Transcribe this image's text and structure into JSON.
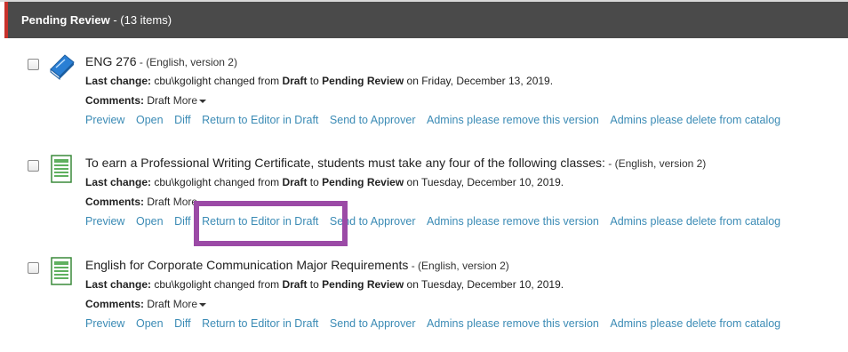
{
  "header": {
    "title": "Pending Review",
    "count": " - (13 items)"
  },
  "labels": {
    "last_change": "Last change:",
    "comments": "Comments:",
    "changed_from": " changed from ",
    "to": " to ",
    "on": " on "
  },
  "actions": [
    "Preview",
    "Open",
    "Diff",
    "Return to Editor in Draft",
    "Send to Approver",
    "Admins please remove this version",
    "Admins please delete from catalog"
  ],
  "items": [
    {
      "icon": "book-icon",
      "title": "ENG 276",
      "meta": " - (English, version 2)",
      "user": "cbu\\kgolight",
      "from_state": "Draft",
      "to_state": "Pending Review",
      "date": "Friday, December 13, 2019.",
      "comment": "Draft",
      "more": "More"
    },
    {
      "icon": "document-icon",
      "title": "To earn a Professional Writing Certificate, students must take any four of the following classes:",
      "meta": " - (English, version 2)",
      "user": "cbu\\kgolight",
      "from_state": "Draft",
      "to_state": "Pending Review",
      "date": "Tuesday, December 10, 2019.",
      "comment": "Draft",
      "more": "More"
    },
    {
      "icon": "document-icon",
      "title": "English for Corporate Communication Major Requirements",
      "meta": " - (English, version 2)",
      "user": "cbu\\kgolight",
      "from_state": "Draft",
      "to_state": "Pending Review",
      "date": "Tuesday, December 10, 2019.",
      "comment": "Draft",
      "more": "More"
    }
  ]
}
